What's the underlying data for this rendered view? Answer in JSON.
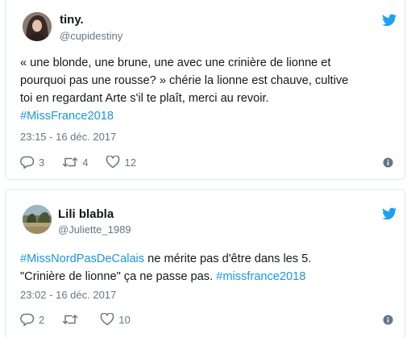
{
  "accent": "#1b95e0",
  "tweets": [
    {
      "name": "tiny.",
      "handle": "@cupidestiny",
      "text_lines": [
        "« une blonde, une brune, une avec une crinière de lionne et",
        "pourquoi pas une rousse? » chérie la lionne est chauve, cultive",
        "toi en regardant Arte s'il te plaît, merci au revoir."
      ],
      "hashtag_line": "#MissFrance2018",
      "timestamp": "23:15 - 16 déc. 2017",
      "replies": "3",
      "retweets": "4",
      "likes": "12"
    },
    {
      "name": "Lili blabla",
      "handle": "@Juliette_1989",
      "text_line1_hashtag": "#MissNordPasDeCalais",
      "text_line1_rest": " ne mérite pas d'être dans les 5.",
      "text_line2_plain": "\"Crinière de lionne\" ça ne passe pas. ",
      "text_line2_hashtag": "#missfrance2018",
      "timestamp": "23:02 - 16 déc. 2017",
      "replies": "2",
      "retweets": "",
      "likes": "10"
    }
  ]
}
